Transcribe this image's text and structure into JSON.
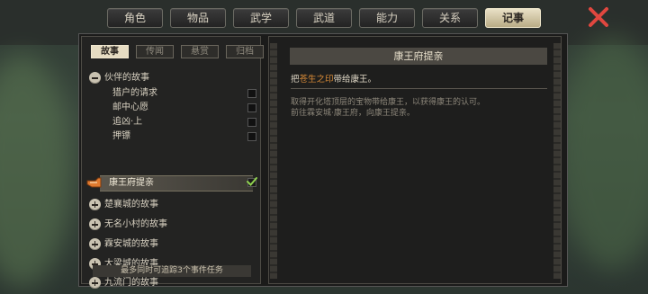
{
  "tabs": [
    {
      "label": "角色",
      "active": false
    },
    {
      "label": "物品",
      "active": false
    },
    {
      "label": "武学",
      "active": false
    },
    {
      "label": "武道",
      "active": false
    },
    {
      "label": "能力",
      "active": false
    },
    {
      "label": "关系",
      "active": false
    },
    {
      "label": "记事",
      "active": true
    }
  ],
  "subtabs": [
    {
      "label": "故事",
      "active": true
    },
    {
      "label": "传闻",
      "active": false
    },
    {
      "label": "悬赏",
      "active": false
    },
    {
      "label": "归档",
      "active": false
    }
  ],
  "quest_list": {
    "group_open": "伙伴的故事",
    "subitems": [
      {
        "label": "猎户的请求",
        "checked": false
      },
      {
        "label": "邮中心愿",
        "checked": false
      },
      {
        "label": "追凶·上",
        "checked": false
      },
      {
        "label": "押镖",
        "checked": false
      },
      {
        "label": "康王府提亲",
        "checked": true,
        "selected": true
      }
    ],
    "groups_closed": [
      "楚襄城的故事",
      "无名小村的故事",
      "霖安城的故事",
      "大梁城的故事",
      "九流门的故事"
    ],
    "footer": "最多同时可追踪3个事件任务"
  },
  "detail": {
    "title": "康王府提亲",
    "line_prefix": "把",
    "line_highlight": "苍生之印",
    "line_suffix": "带给康王。",
    "desc_line1": "取得开化塔顶层的宝物带给康王，以获得康王的认可。",
    "desc_line2": "前往霖安城·康王府，向康王提亲。"
  },
  "colors": {
    "highlight": "#d98b37",
    "close": "#e0473f",
    "check": "#8fd14f"
  }
}
